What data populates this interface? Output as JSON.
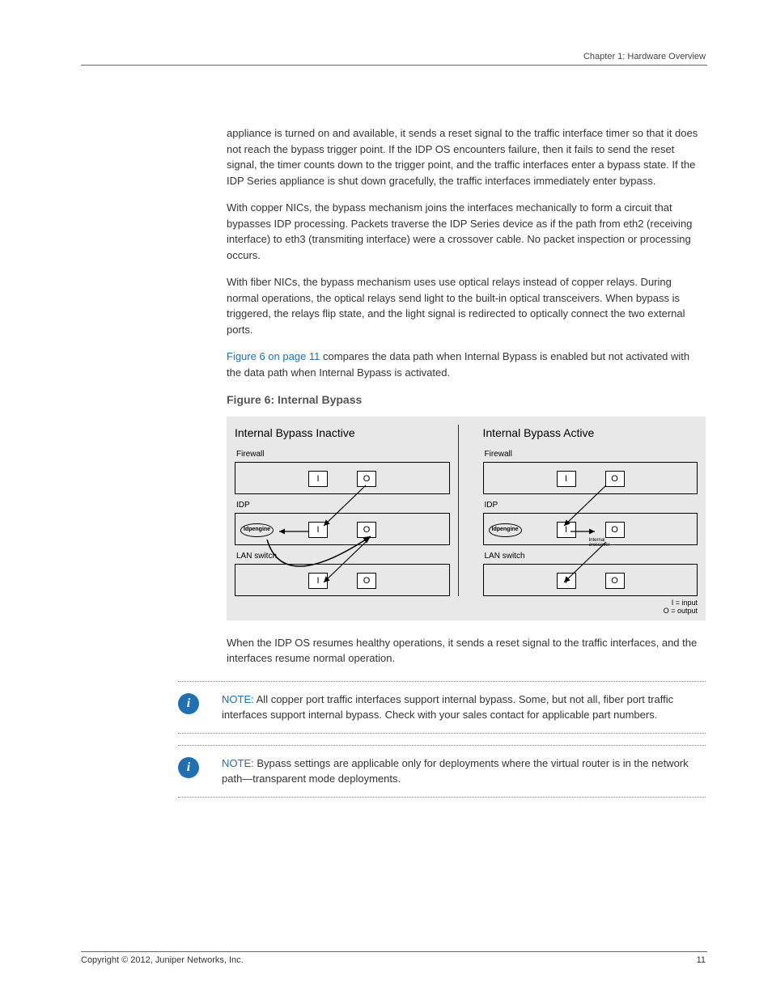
{
  "header": {
    "chapter": "Chapter 1: Hardware Overview"
  },
  "body": {
    "p1": "appliance is turned on and available, it sends a reset signal to the traffic interface timer so that it does not reach the bypass trigger point. If the IDP OS encounters failure, then it fails to send the reset signal, the timer counts down to the trigger point, and the traffic interfaces enter a bypass state. If the IDP Series appliance is shut down gracefully, the traffic interfaces immediately enter bypass.",
    "p2": "With copper NICs, the bypass mechanism joins the interfaces mechanically to form a circuit that bypasses IDP processing. Packets traverse the IDP Series device as if the path from eth2 (receiving interface) to eth3 (transmiting interface) were a crossover cable. No packet inspection or processing occurs.",
    "p3": "With fiber NICs, the bypass mechanism uses use optical relays instead of copper relays. During normal operations, the optical relays send light to the built-in optical transceivers. When bypass is triggered, the relays flip state, and the light signal is redirected to optically connect the two external ports.",
    "p4_pre": "",
    "p4_link": "Figure 6 on page 11",
    "p4_post": " compares the data path when Internal Bypass is enabled but not activated with the data path when Internal Bypass is activated.",
    "fig_caption": "Figure 6: Internal Bypass",
    "p5": "When the IDP OS resumes healthy operations, it sends a reset signal to the traffic interfaces, and the interfaces resume normal operation."
  },
  "diagram": {
    "left_title": "Internal Bypass Inactive",
    "right_title": "Internal Bypass Active",
    "dev_firewall": "Firewall",
    "dev_idp": "IDP",
    "dev_lan": "LAN switch",
    "engine": "Idpengine",
    "port_in": "I",
    "port_out": "O",
    "internal_crossover": "Internal\ncrossover",
    "legend_i": "I  =  input",
    "legend_o": "O  =  output"
  },
  "notes": {
    "label": "NOTE:",
    "n1": "All copper port traffic interfaces support internal bypass. Some, but not all, fiber port traffic interfaces support internal bypass. Check with your sales contact for applicable part numbers.",
    "n2": "Bypass settings are applicable only for deployments where the virtual router is in the network path—transparent mode deployments."
  },
  "footer": {
    "copyright": "Copyright © 2012, Juniper Networks, Inc.",
    "page": "11"
  }
}
